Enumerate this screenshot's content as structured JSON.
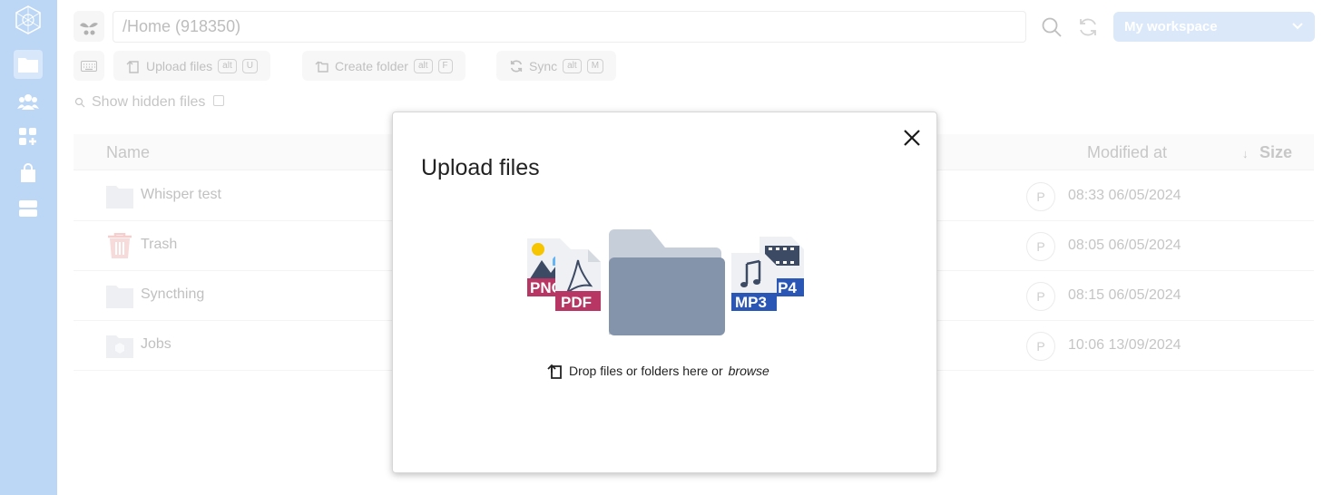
{
  "sidebar": {
    "items": [
      {
        "icon": "folder-icon",
        "active": true
      },
      {
        "icon": "users-icon",
        "active": false
      },
      {
        "icon": "apps-add-icon",
        "active": false
      },
      {
        "icon": "shopping-bag-icon",
        "active": false
      },
      {
        "icon": "storage-drive-icon",
        "active": false
      }
    ]
  },
  "topbar": {
    "path": "/Home (918350)",
    "workspace": "My workspace"
  },
  "actions": {
    "upload": {
      "label": "Upload files",
      "mod": "alt",
      "key": "U"
    },
    "create_folder": {
      "label": "Create folder",
      "mod": "alt",
      "key": "F"
    },
    "sync": {
      "label": "Sync",
      "mod": "alt",
      "key": "M"
    }
  },
  "show_hidden_label": "Show hidden files",
  "table": {
    "headers": {
      "name": "Name",
      "modified": "Modified at",
      "size": "Size"
    },
    "rows": [
      {
        "name": "Whisper test",
        "owner": "P",
        "modified": "08:33 06/05/2024",
        "icon": "folder-icon"
      },
      {
        "name": "Trash",
        "owner": "P",
        "modified": "08:05 06/05/2024",
        "icon": "trash-icon"
      },
      {
        "name": "Syncthing",
        "owner": "P",
        "modified": "08:15 06/05/2024",
        "icon": "folder-icon"
      },
      {
        "name": "Jobs",
        "owner": "P",
        "modified": "10:06 13/09/2024",
        "icon": "folder-package-icon"
      }
    ]
  },
  "modal": {
    "title": "Upload files",
    "drop_text": "Drop files or folders here or",
    "browse": "browse",
    "file_badges": [
      "PNG",
      "PDF",
      "MP3",
      "MP4"
    ]
  },
  "colors": {
    "sidebar": "#bcd7f6",
    "workspace": "#c7dcf6",
    "pdf_badge": "#b83663",
    "mp_badge": "#2a56b5",
    "folder": "#8494ab"
  }
}
